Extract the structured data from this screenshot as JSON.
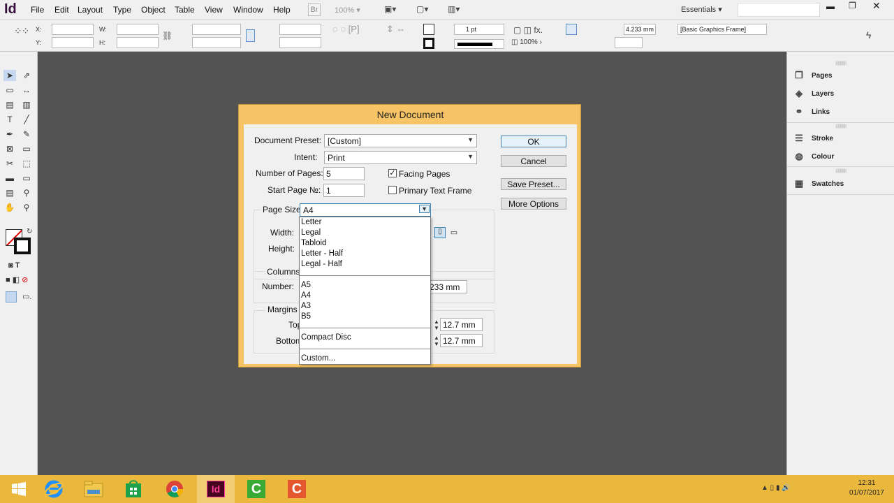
{
  "app": {
    "logo": "Id",
    "workspace": "Essentials"
  },
  "menu": [
    "File",
    "Edit",
    "Layout",
    "Type",
    "Object",
    "Table",
    "View",
    "Window",
    "Help"
  ],
  "menubar_extra": {
    "br_label": "Br",
    "zoom": "100%"
  },
  "control": {
    "x_label": "X:",
    "y_label": "Y:",
    "w_label": "W:",
    "h_label": "H:",
    "stroke_weight": "1 pt",
    "offset": "4.233 mm",
    "scale": "100%",
    "frame_style": "[Basic Graphics Frame]"
  },
  "panels": [
    {
      "label": "Pages",
      "icon": "pages-icon"
    },
    {
      "label": "Layers",
      "icon": "layers-icon"
    },
    {
      "label": "Links",
      "icon": "links-icon"
    },
    {
      "label": "Stroke",
      "icon": "stroke-icon"
    },
    {
      "label": "Colour",
      "icon": "colour-icon"
    },
    {
      "label": "Swatches",
      "icon": "swatches-icon"
    }
  ],
  "dialog": {
    "title": "New Document",
    "preset_label": "Document Preset:",
    "preset_value": "[Custom]",
    "intent_label": "Intent:",
    "intent_value": "Print",
    "pages_label": "Number of Pages:",
    "pages_value": "5",
    "start_label": "Start Page №:",
    "start_value": "1",
    "facing_label": "Facing Pages",
    "facing_checked": true,
    "primary_label": "Primary Text Frame",
    "primary_checked": false,
    "page_size_label": "Page Size:",
    "page_size_value": "A4",
    "width_label": "Width:",
    "height_label": "Height:",
    "columns_label": "Columns",
    "number_label": "Number:",
    "gutter_value": "233 mm",
    "margins_label": "Margins",
    "top_label": "Top",
    "bottom_label": "Bottom",
    "margin_top": "12.7 mm",
    "margin_bottom": "12.7 mm",
    "buttons": {
      "ok": "OK",
      "cancel": "Cancel",
      "save_preset": "Save Preset...",
      "more_options": "More Options"
    }
  },
  "page_size_options": {
    "group1": [
      "Letter",
      "Legal",
      "Tabloid",
      "Letter - Half",
      "Legal - Half"
    ],
    "group2": [
      "A5",
      "A4",
      "A3",
      "B5"
    ],
    "group3": [
      "Compact Disc"
    ],
    "group4": [
      "Custom..."
    ]
  },
  "taskbar": {
    "apps": [
      "windows-start",
      "internet-explorer",
      "file-explorer",
      "store",
      "chrome",
      "indesign",
      "camtasia-green",
      "camtasia-orange"
    ],
    "time": "12:31",
    "date": "01/07/2017"
  }
}
